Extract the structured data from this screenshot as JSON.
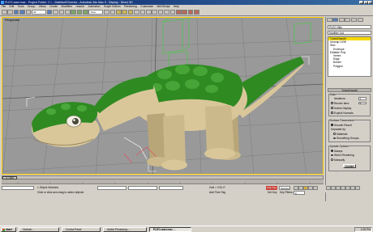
{
  "window": {
    "title": "PLEO-start.max  -  Project Folder: C:\\...\\3dsMax9\\Scenes  -  Autodesk 3ds Max 9  -  Display : Direct 3D"
  },
  "menu": [
    "File",
    "Edit",
    "Tools",
    "Group",
    "Views",
    "Create",
    "Modifiers",
    "reactor",
    "Animation",
    "Graph Editors",
    "Rendering",
    "Customize",
    "MAXScript",
    "Help"
  ],
  "toolbar": {
    "selection_filter": "All",
    "view_dropdown": "View"
  },
  "viewport": {
    "label": "Perspective"
  },
  "command_panel": {
    "object_name": "PLEO Skin",
    "modifier_list": "Modifier List",
    "stack": [
      "TurboSmooth",
      "Unwrap UVW",
      "Skin",
      "Envelope",
      "Editable Poly",
      "Vertex",
      "Edge",
      "Border",
      "Polygon"
    ],
    "selected_index": 0,
    "rollout_title": "TurboSmooth",
    "main_label": "Main",
    "iterations_label": "Iterations:",
    "iterations_value": "1",
    "render_iters_label": "Render Iters:",
    "render_iters_value": "2",
    "isoline_display": "Isoline Display",
    "explicit_normals": "Explicit Normals",
    "surface_params": "Surface Parameters",
    "smooth_result": "Smooth Result",
    "separate_by": "Separate by:",
    "materials": "Materials",
    "smoothing_groups": "Smoothing Groups",
    "update_options": "Update Options",
    "always": "Always",
    "when_rendering": "When Rendering",
    "manually": "Manually",
    "update_button": "Update"
  },
  "time": {
    "slider_label": "0 / 300"
  },
  "status": {
    "selection": "1 Object Selected",
    "prompt": "Click or click-and-drag to select objects",
    "grid": "Grid = 0'10.0\"",
    "add_time_tag": "Add Time Tag",
    "auto_key": "Auto Key",
    "set_key": "Set Key",
    "key_filters": "Key Filters...",
    "selected": "Selected",
    "frame": "0"
  },
  "taskbar": {
    "start": "start",
    "items": [
      "Outlook...",
      "Control Panel",
      "Adobe Photoshop ...",
      "PLEO-start.max ..."
    ],
    "active_index": 3,
    "clock": "2:25 PM"
  },
  "colors": {
    "title_bar": "#0a246a",
    "viewport_bg": "#999999",
    "active_border": "#ffcc00",
    "selection_highlight": "#f5d800",
    "auto_key": "#c7423c",
    "creature_green": "#2f8a22",
    "creature_belly": "#d9c79a"
  }
}
